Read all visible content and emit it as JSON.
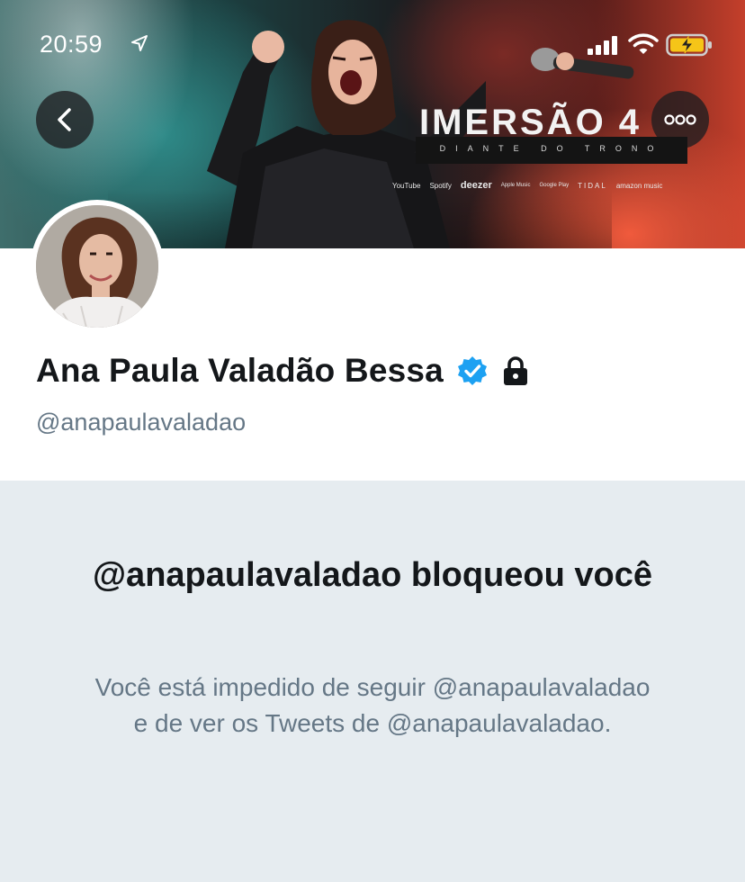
{
  "status_bar": {
    "time": "20:59",
    "icons": [
      "location-arrow-icon",
      "cellular-signal-icon",
      "wifi-icon",
      "battery-charging-icon"
    ],
    "battery_color": "#f5c518"
  },
  "banner": {
    "album_title": "IMERSÃO 4",
    "album_subtitle": "DIANTE DO TRONO",
    "platforms": [
      "YouTube",
      "Spotify",
      "deezer",
      "Apple Music",
      "Google Play",
      "TIDAL",
      "amazon music"
    ]
  },
  "nav": {
    "back_icon": "chevron-left-icon",
    "more_icon": "more-dots-icon"
  },
  "profile": {
    "display_name": "Ana Paula Valadão Bessa",
    "handle": "@anapaulavaladao",
    "verified": true,
    "protected": true,
    "verified_color": "#1da1f2"
  },
  "blocked_notice": {
    "title": "@anapaulavaladao bloqueou você",
    "body": "Você está impedido de seguir @anapaulavaladao e de ver os Tweets de @anapaulavaladao."
  }
}
